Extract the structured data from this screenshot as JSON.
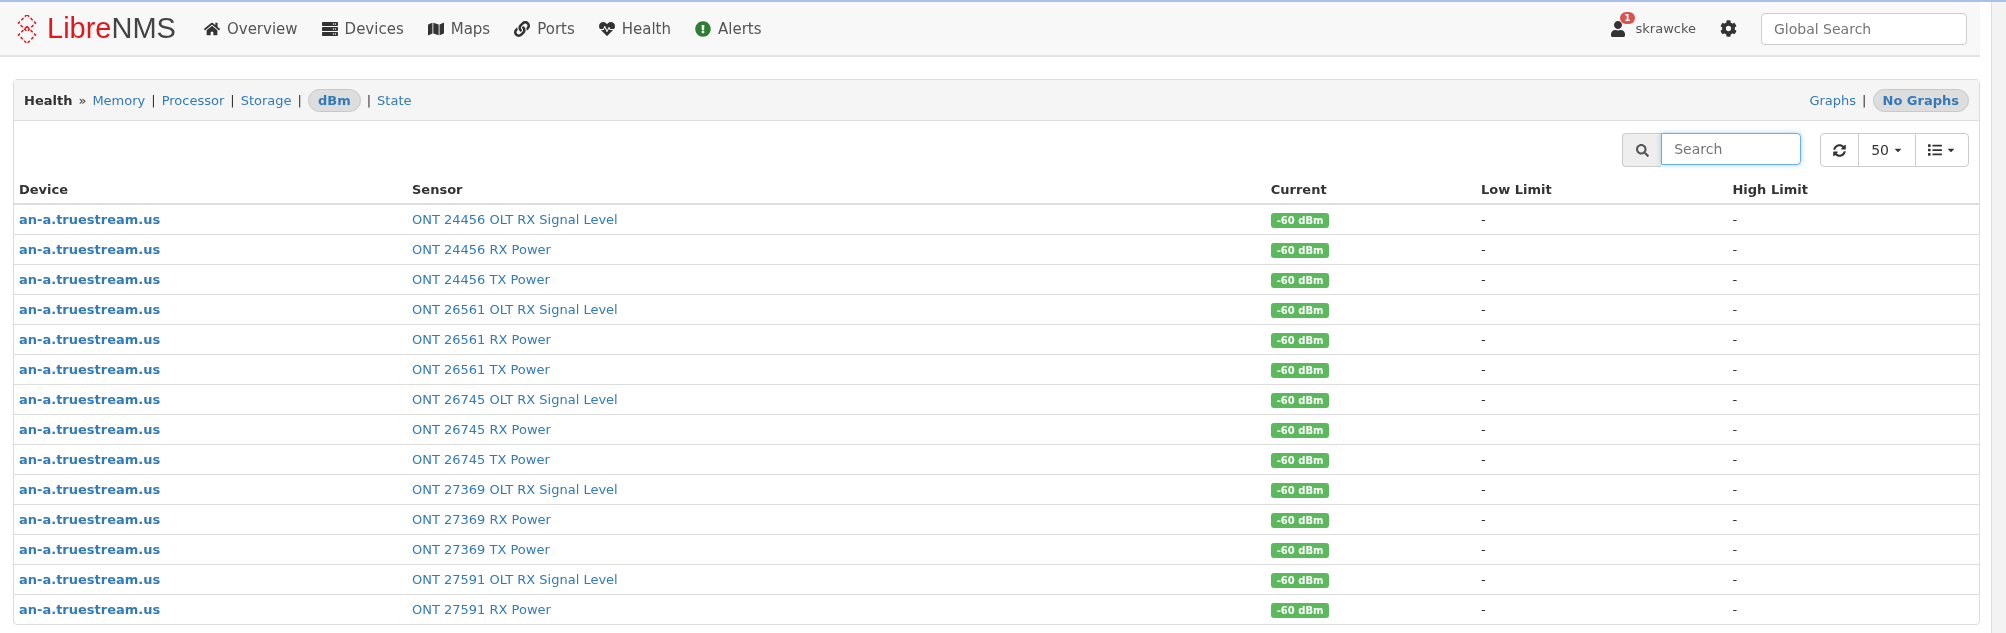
{
  "navbar": {
    "logo": {
      "brand_a": "Libre",
      "brand_b": "NMS"
    },
    "items": [
      {
        "label": "Overview"
      },
      {
        "label": "Devices"
      },
      {
        "label": "Maps"
      },
      {
        "label": "Ports"
      },
      {
        "label": "Health"
      },
      {
        "label": "Alerts"
      }
    ],
    "user": {
      "name": "skrawcke",
      "badge": "1"
    },
    "global_search": {
      "placeholder": "Global Search"
    }
  },
  "breadcrumb": {
    "title": "Health",
    "separator": "»",
    "pipe": "|",
    "links": [
      {
        "label": "Memory",
        "selected": false
      },
      {
        "label": "Processor",
        "selected": false
      },
      {
        "label": "Storage",
        "selected": false
      },
      {
        "label": "dBm",
        "selected": true
      },
      {
        "label": "State",
        "selected": false
      }
    ],
    "views": [
      {
        "label": "Graphs",
        "selected": false
      },
      {
        "label": "No Graphs",
        "selected": true
      }
    ]
  },
  "toolbar": {
    "search": {
      "placeholder": "Search"
    },
    "page_size": "50"
  },
  "table": {
    "columns": [
      "Device",
      "Sensor",
      "Current",
      "Low Limit",
      "High Limit"
    ],
    "rows": [
      {
        "device": "an-a.truestream.us",
        "sensor": "ONT 24456 OLT RX Signal Level",
        "current": "-60 dBm",
        "low": "-",
        "high": "-"
      },
      {
        "device": "an-a.truestream.us",
        "sensor": "ONT 24456 RX Power",
        "current": "-60 dBm",
        "low": "-",
        "high": "-"
      },
      {
        "device": "an-a.truestream.us",
        "sensor": "ONT 24456 TX Power",
        "current": "-60 dBm",
        "low": "-",
        "high": "-"
      },
      {
        "device": "an-a.truestream.us",
        "sensor": "ONT 26561 OLT RX Signal Level",
        "current": "-60 dBm",
        "low": "-",
        "high": "-"
      },
      {
        "device": "an-a.truestream.us",
        "sensor": "ONT 26561 RX Power",
        "current": "-60 dBm",
        "low": "-",
        "high": "-"
      },
      {
        "device": "an-a.truestream.us",
        "sensor": "ONT 26561 TX Power",
        "current": "-60 dBm",
        "low": "-",
        "high": "-"
      },
      {
        "device": "an-a.truestream.us",
        "sensor": "ONT 26745 OLT RX Signal Level",
        "current": "-60 dBm",
        "low": "-",
        "high": "-"
      },
      {
        "device": "an-a.truestream.us",
        "sensor": "ONT 26745 RX Power",
        "current": "-60 dBm",
        "low": "-",
        "high": "-"
      },
      {
        "device": "an-a.truestream.us",
        "sensor": "ONT 26745 TX Power",
        "current": "-60 dBm",
        "low": "-",
        "high": "-"
      },
      {
        "device": "an-a.truestream.us",
        "sensor": "ONT 27369 OLT RX Signal Level",
        "current": "-60 dBm",
        "low": "-",
        "high": "-"
      },
      {
        "device": "an-a.truestream.us",
        "sensor": "ONT 27369 RX Power",
        "current": "-60 dBm",
        "low": "-",
        "high": "-"
      },
      {
        "device": "an-a.truestream.us",
        "sensor": "ONT 27369 TX Power",
        "current": "-60 dBm",
        "low": "-",
        "high": "-"
      },
      {
        "device": "an-a.truestream.us",
        "sensor": "ONT 27591 OLT RX Signal Level",
        "current": "-60 dBm",
        "low": "-",
        "high": "-"
      },
      {
        "device": "an-a.truestream.us",
        "sensor": "ONT 27591 RX Power",
        "current": "-60 dBm",
        "low": "-",
        "high": "-"
      }
    ]
  }
}
